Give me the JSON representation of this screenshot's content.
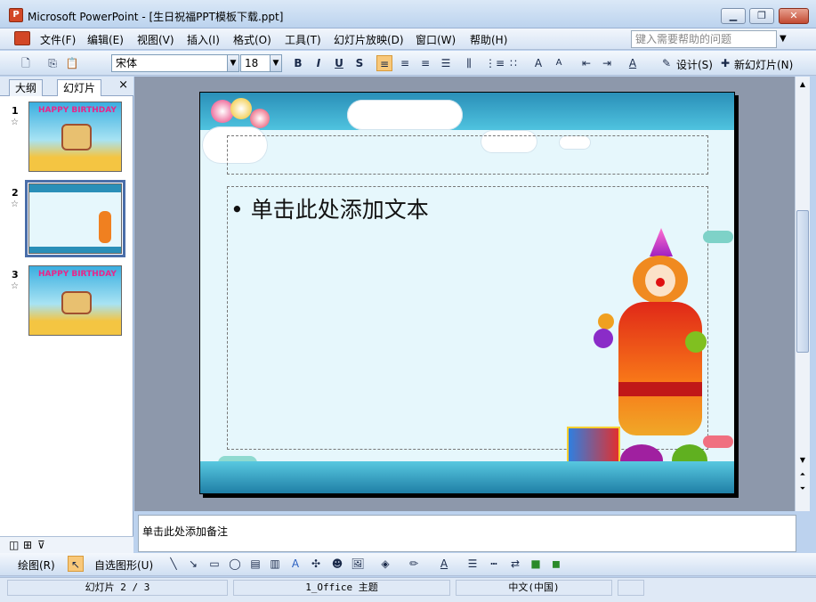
{
  "window": {
    "title": "Microsoft PowerPoint - [生日祝福PPT模板下载.ppt]",
    "app_icon": "powerpoint-icon",
    "controls": [
      "minimize-icon",
      "restore-icon",
      "close-icon"
    ]
  },
  "menu": {
    "items": [
      "文件(F)",
      "编辑(E)",
      "视图(V)",
      "插入(I)",
      "格式(O)",
      "工具(T)",
      "幻灯片放映(D)",
      "窗口(W)",
      "帮助(H)"
    ],
    "help_placeholder": "键入需要帮助的问题"
  },
  "format_toolbar": {
    "font": "宋体",
    "size": "18",
    "bold": "B",
    "italic": "I",
    "underline": "U",
    "shadow": "S",
    "design_label": "设计(S)",
    "new_slide_label": "新幻灯片(N)"
  },
  "panel": {
    "tabs": [
      "大纲",
      "幻灯片"
    ],
    "close": "×",
    "thumbs": [
      {
        "num": "1",
        "text": "HAPPY BIRTHDAY"
      },
      {
        "num": "2",
        "text": ""
      },
      {
        "num": "3",
        "text": "HAPPY BIRTHDAY"
      }
    ]
  },
  "slide": {
    "bullet": "•",
    "body_text": "单击此处添加文本"
  },
  "notes": {
    "text": "单击此处添加备注"
  },
  "draw_toolbar": {
    "draw_label": "绘图(R)",
    "autoshape_label": "自选图形(U)"
  },
  "status": {
    "slide_pos": "幻灯片 2 / 3",
    "theme": "1_Office 主题",
    "language": "中文(中国)"
  },
  "colors": {
    "accent": "#4a6ea9",
    "slide_bg": "#e6f7fc",
    "band": "#2a8fb8"
  }
}
